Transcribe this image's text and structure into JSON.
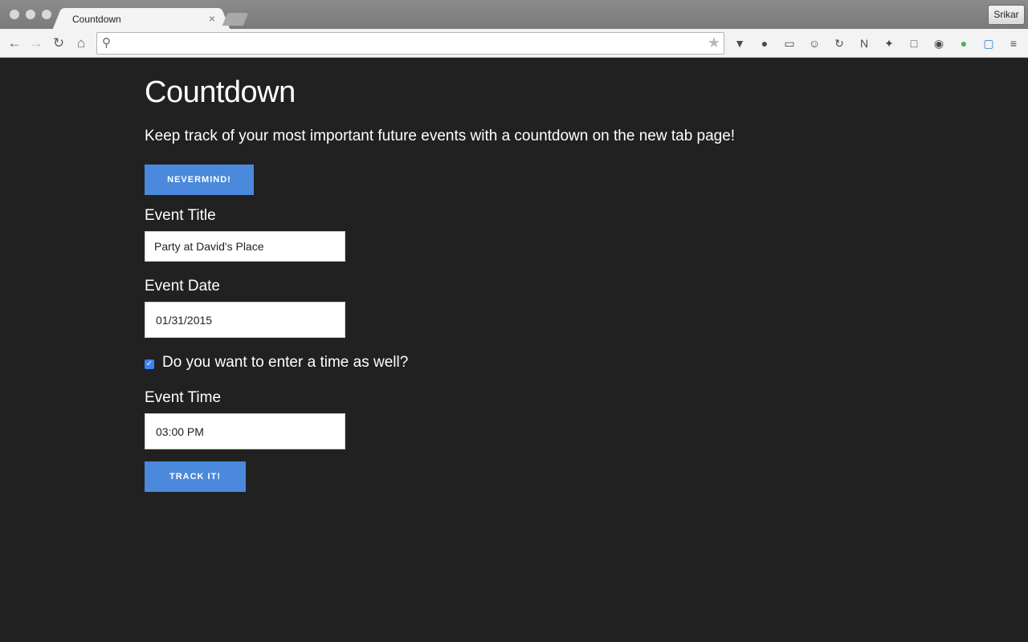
{
  "browser": {
    "tab_title": "Countdown",
    "tab_close": "×",
    "profile_name": "Srikar",
    "omnibox_value": ""
  },
  "page": {
    "title": "Countdown",
    "subtitle": "Keep track of your most important future events with a countdown on the new tab page!",
    "nevermind_label": "NEVERMIND!",
    "event_title_label": "Event Title",
    "event_title_value": "Party at David's Place",
    "event_date_label": "Event Date",
    "event_date_value": "01/31/2015",
    "time_checkbox_label": "Do you want to enter a time as well?",
    "time_checkbox_checked": true,
    "event_time_label": "Event Time",
    "event_time_value": "03:00 PM",
    "track_label": "TRACK IT!"
  },
  "colors": {
    "accent": "#4a89dc",
    "page_background": "#212121"
  }
}
